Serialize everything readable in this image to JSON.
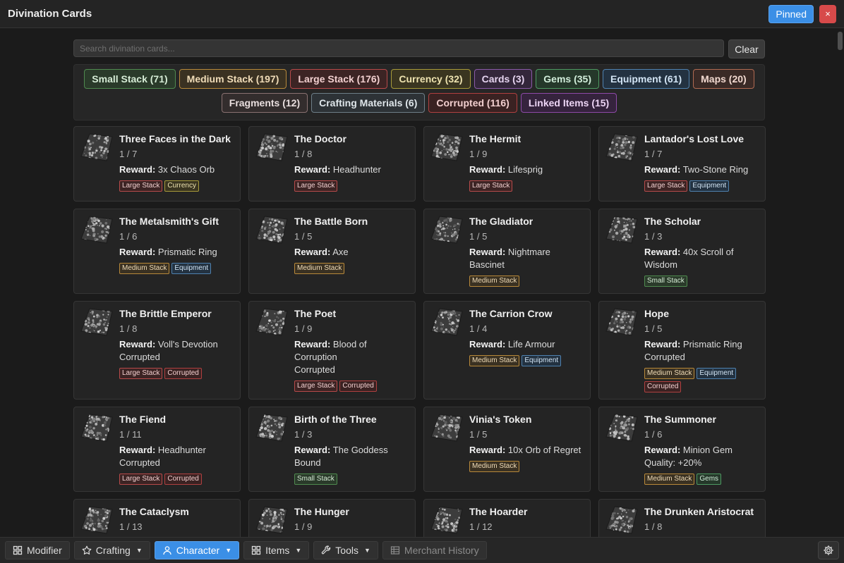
{
  "window": {
    "title": "Divination Cards",
    "pinned_label": "Pinned",
    "close_label": "×"
  },
  "search": {
    "placeholder": "Search divination cards...",
    "value": "",
    "clear_label": "Clear"
  },
  "filters": [
    {
      "label": "Small Stack (71)",
      "kind": "small"
    },
    {
      "label": "Medium Stack (197)",
      "kind": "medium"
    },
    {
      "label": "Large Stack (176)",
      "kind": "large"
    },
    {
      "label": "Currency (32)",
      "kind": "currency"
    },
    {
      "label": "Cards (3)",
      "kind": "cards"
    },
    {
      "label": "Gems (35)",
      "kind": "gems"
    },
    {
      "label": "Equipment (61)",
      "kind": "equipment"
    },
    {
      "label": "Maps (20)",
      "kind": "maps"
    },
    {
      "label": "Fragments (12)",
      "kind": "fragments"
    },
    {
      "label": "Crafting Materials (6)",
      "kind": "crafting"
    },
    {
      "label": "Corrupted (116)",
      "kind": "corrupted"
    },
    {
      "label": "Linked Items (15)",
      "kind": "linked"
    }
  ],
  "reward_prefix": "Reward:",
  "cards": [
    {
      "name": "Three Faces in the Dark",
      "stack": "1 / 7",
      "reward": "3x Chaos Orb",
      "extra": "",
      "tags": [
        {
          "label": "Large Stack",
          "kind": "large"
        },
        {
          "label": "Currency",
          "kind": "currency"
        }
      ]
    },
    {
      "name": "The Doctor",
      "stack": "1 / 8",
      "reward": "Headhunter",
      "extra": "",
      "tags": [
        {
          "label": "Large Stack",
          "kind": "large"
        }
      ]
    },
    {
      "name": "The Hermit",
      "stack": "1 / 9",
      "reward": "Lifesprig",
      "extra": "",
      "tags": [
        {
          "label": "Large Stack",
          "kind": "large"
        }
      ]
    },
    {
      "name": "Lantador's Lost Love",
      "stack": "1 / 7",
      "reward": "Two-Stone Ring",
      "extra": "",
      "tags": [
        {
          "label": "Large Stack",
          "kind": "large"
        },
        {
          "label": "Equipment",
          "kind": "equipment"
        }
      ]
    },
    {
      "name": "The Metalsmith's Gift",
      "stack": "1 / 6",
      "reward": "Prismatic Ring",
      "extra": "",
      "tags": [
        {
          "label": "Medium Stack",
          "kind": "medium"
        },
        {
          "label": "Equipment",
          "kind": "equipment"
        }
      ]
    },
    {
      "name": "The Battle Born",
      "stack": "1 / 5",
      "reward": "Axe",
      "extra": "",
      "tags": [
        {
          "label": "Medium Stack",
          "kind": "medium"
        }
      ]
    },
    {
      "name": "The Gladiator",
      "stack": "1 / 5",
      "reward": "Nightmare Bascinet",
      "extra": "",
      "tags": [
        {
          "label": "Medium Stack",
          "kind": "medium"
        }
      ]
    },
    {
      "name": "The Scholar",
      "stack": "1 / 3",
      "reward": "40x Scroll of Wisdom",
      "extra": "",
      "tags": [
        {
          "label": "Small Stack",
          "kind": "small"
        }
      ]
    },
    {
      "name": "The Brittle Emperor",
      "stack": "1 / 8",
      "reward": "Voll's Devotion",
      "extra": "Corrupted",
      "tags": [
        {
          "label": "Large Stack",
          "kind": "large"
        },
        {
          "label": "Corrupted",
          "kind": "corrupted"
        }
      ]
    },
    {
      "name": "The Poet",
      "stack": "1 / 9",
      "reward": "Blood of Corruption",
      "extra": "Corrupted",
      "tags": [
        {
          "label": "Large Stack",
          "kind": "large"
        },
        {
          "label": "Corrupted",
          "kind": "corrupted"
        }
      ]
    },
    {
      "name": "The Carrion Crow",
      "stack": "1 / 4",
      "reward": "Life Armour",
      "extra": "",
      "tags": [
        {
          "label": "Medium Stack",
          "kind": "medium"
        },
        {
          "label": "Equipment",
          "kind": "equipment"
        }
      ]
    },
    {
      "name": "Hope",
      "stack": "1 / 5",
      "reward": "Prismatic Ring",
      "extra": "Corrupted",
      "tags": [
        {
          "label": "Medium Stack",
          "kind": "medium"
        },
        {
          "label": "Equipment",
          "kind": "equipment"
        },
        {
          "label": "Corrupted",
          "kind": "corrupted"
        }
      ]
    },
    {
      "name": "The Fiend",
      "stack": "1 / 11",
      "reward": "Headhunter",
      "extra": "Corrupted",
      "tags": [
        {
          "label": "Large Stack",
          "kind": "large"
        },
        {
          "label": "Corrupted",
          "kind": "corrupted"
        }
      ]
    },
    {
      "name": "Birth of the Three",
      "stack": "1 / 3",
      "reward": "The Goddess Bound",
      "extra": "",
      "tags": [
        {
          "label": "Small Stack",
          "kind": "small"
        }
      ]
    },
    {
      "name": "Vinia's Token",
      "stack": "1 / 5",
      "reward": "10x Orb of Regret",
      "extra": "",
      "tags": [
        {
          "label": "Medium Stack",
          "kind": "medium"
        }
      ]
    },
    {
      "name": "The Summoner",
      "stack": "1 / 6",
      "reward": "Minion Gem",
      "extra": "Quality: +20%",
      "tags": [
        {
          "label": "Medium Stack",
          "kind": "medium"
        },
        {
          "label": "Gems",
          "kind": "gems"
        }
      ]
    },
    {
      "name": "The Cataclysm",
      "stack": "1 / 13",
      "reward": "",
      "extra": "",
      "tags": []
    },
    {
      "name": "The Hunger",
      "stack": "1 / 9",
      "reward": "",
      "extra": "",
      "tags": []
    },
    {
      "name": "The Hoarder",
      "stack": "1 / 12",
      "reward": "",
      "extra": "",
      "tags": []
    },
    {
      "name": "The Drunken Aristocrat",
      "stack": "1 / 8",
      "reward": "",
      "extra": "",
      "tags": []
    }
  ],
  "palette": {
    "small": {
      "bg": "#2a3a2a",
      "border": "#4f8a4f",
      "text": "#d6ecd6"
    },
    "medium": {
      "bg": "#3a3122",
      "border": "#b8893a",
      "text": "#f0dcb8"
    },
    "large": {
      "bg": "#3c2424",
      "border": "#b84a4a",
      "text": "#f2d0d0"
    },
    "currency": {
      "bg": "#3a3520",
      "border": "#a89b3a",
      "text": "#eee3b0"
    },
    "cards": {
      "bg": "#33263a",
      "border": "#8a5aa8",
      "text": "#e6d4f0"
    },
    "gems": {
      "bg": "#25382a",
      "border": "#4e9a62",
      "text": "#d2eedb"
    },
    "equipment": {
      "bg": "#233241",
      "border": "#4f82b0",
      "text": "#d2e4f4"
    },
    "maps": {
      "bg": "#3a2a26",
      "border": "#b06a52",
      "text": "#f2d9d0"
    },
    "fragments": {
      "bg": "#332d2d",
      "border": "#8a7272",
      "text": "#e8dede"
    },
    "crafting": {
      "bg": "#2d3236",
      "border": "#6e7e88",
      "text": "#dfe6ea"
    },
    "corrupted": {
      "bg": "#3a2222",
      "border": "#b04040",
      "text": "#f2cfcf"
    },
    "linked": {
      "bg": "#35233d",
      "border": "#8e4aa8",
      "text": "#ecd4f4"
    }
  },
  "bottombar": {
    "modifier": "Modifier",
    "crafting": "Crafting",
    "character": "Character",
    "items": "Items",
    "tools": "Tools",
    "merchant": "Merchant History"
  }
}
